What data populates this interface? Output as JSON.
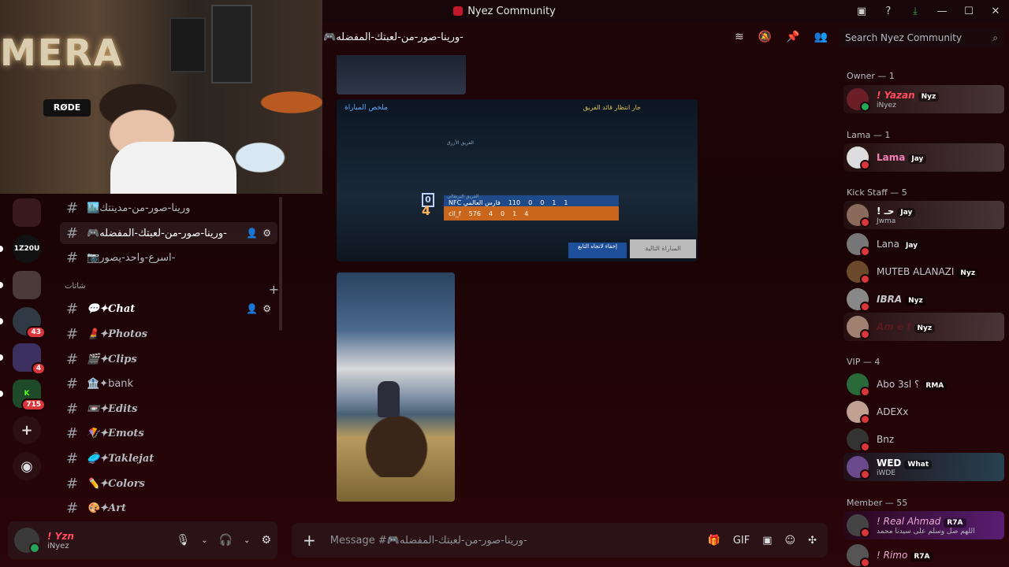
{
  "window": {
    "title": "Nyez Community",
    "controls": [
      "inbox-icon",
      "help-icon",
      "download-icon",
      "minimize-icon",
      "maximize-icon",
      "close-icon"
    ]
  },
  "webcam": {
    "mic_brand": "RØDE",
    "neon_sign": "MERA"
  },
  "servers": [
    {
      "label": "",
      "badge": ""
    },
    {
      "label": "1Z20U",
      "badge": ""
    },
    {
      "label": "",
      "badge": ""
    },
    {
      "label": "",
      "badge": "43"
    },
    {
      "label": "",
      "badge": "4"
    },
    {
      "label": "K",
      "badge": "715"
    }
  ],
  "channels": {
    "top": [
      {
        "name": "🏙️ورينا-صور-من-مدينتك"
      },
      {
        "name": "🎮ورينا-صور-من-لعبتك-المفضله-"
      },
      {
        "name": "📷اسرع-واحد-يصور-"
      }
    ],
    "category": "شاتات",
    "list": [
      {
        "name": "💬✦Chat"
      },
      {
        "name": "💄✦Photos"
      },
      {
        "name": "🎬✦Clips"
      },
      {
        "name": "🏦✦bank"
      },
      {
        "name": "📼✦Edits"
      },
      {
        "name": "🪁✦Emots"
      },
      {
        "name": "🥏✦Taklejat"
      },
      {
        "name": "✏️✦Colors"
      },
      {
        "name": "🎨✦Art"
      }
    ]
  },
  "user_panel": {
    "name": "! Yzn",
    "status": "iNyez"
  },
  "header": {
    "channel_name": "🎮ورينا-صور-من-لعبتك-المفضله-",
    "search_placeholder": "Search Nyez Community"
  },
  "scoreboard": {
    "tab": "ملخص المباراة",
    "waiting": "جار انتظار قائد الفريق",
    "blue_score": "0",
    "orange_score": "4",
    "blue_team": "الفريق الأزرق",
    "orange_team": "الفريق البرتقالي",
    "blue_row": [
      "NFC فارس العالمي",
      "110",
      "0",
      "0",
      "1",
      "1"
    ],
    "orange_row": [
      "cil_f",
      "576",
      "4",
      "0",
      "1",
      "4"
    ],
    "btn_vote": "إخفاء لانجاه التابع",
    "btn_next": "المباراة التالية"
  },
  "composer": {
    "placeholder": "Message #🎮ورينا-صور-من-لعبتك-المفضله-"
  },
  "members": {
    "owner": {
      "header": "Owner — 1",
      "items": [
        {
          "name": "! Yazan",
          "tag": "Nyz",
          "sub": "iNyez"
        }
      ]
    },
    "lama": {
      "header": "Lama — 1",
      "items": [
        {
          "name": "Lama",
          "tag": "Jay",
          "sub": ""
        }
      ]
    },
    "kick": {
      "header": "Kick Staff — 5",
      "items": [
        {
          "name": "! حـ",
          "tag": "Jay",
          "sub": "Jwma"
        },
        {
          "name": "Lana",
          "tag": "Jay",
          "sub": ""
        },
        {
          "name": "MUTEB ALANAZI",
          "tag": "Nyz",
          "sub": ""
        },
        {
          "name": "IBRA",
          "tag": "Nyz",
          "sub": ""
        },
        {
          "name": "Am e f",
          "tag": "Nyz",
          "sub": ""
        }
      ]
    },
    "vip": {
      "header": "VIP — 4",
      "items": [
        {
          "name": "Abo 3sl ؟",
          "tag": "RMA",
          "sub": ""
        },
        {
          "name": "ADEXx",
          "tag": "",
          "sub": ""
        },
        {
          "name": "Bnz",
          "tag": "",
          "sub": ""
        },
        {
          "name": "WED",
          "tag": "What",
          "sub": "iWDE"
        }
      ]
    },
    "member": {
      "header": "Member — 55",
      "items": [
        {
          "name": "! Real Ahmad",
          "tag": "R7A",
          "sub": "اللهم صل وسلم على سيدنا محمد"
        },
        {
          "name": "! Rimo",
          "tag": "R7A",
          "sub": ""
        }
      ]
    }
  },
  "colors": {
    "accent_red": "#ff4b5c",
    "online": "#23a55a",
    "dnd": "#da373c"
  }
}
